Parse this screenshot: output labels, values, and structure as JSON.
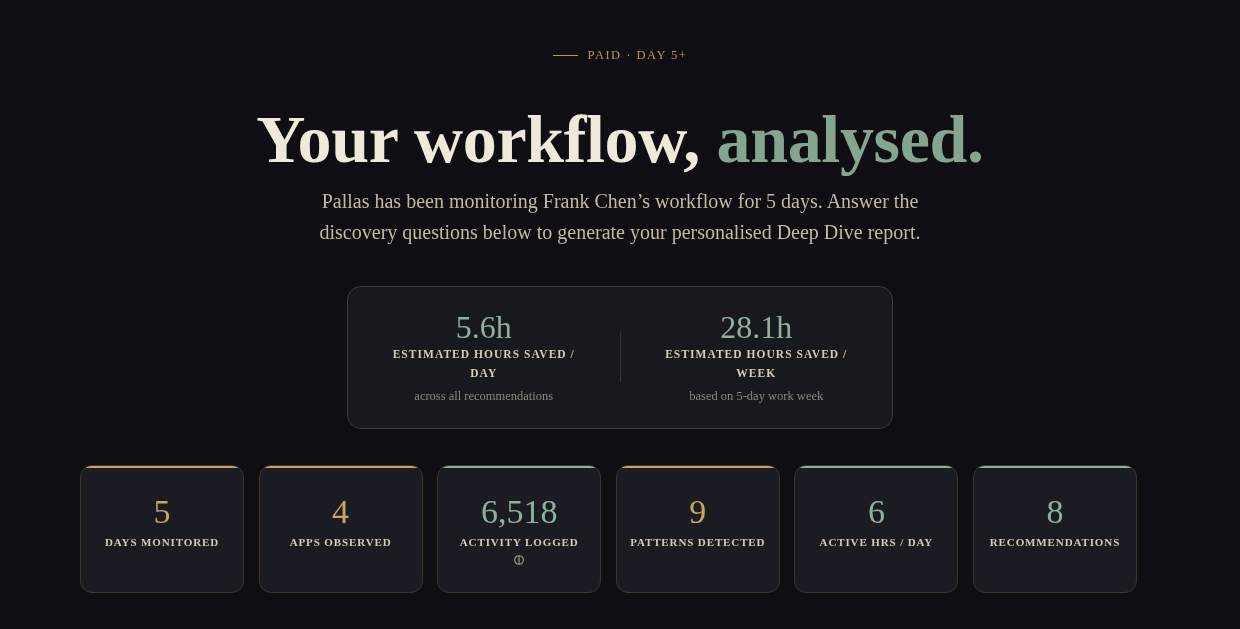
{
  "eyebrow": {
    "text": "PAID · DAY 5+"
  },
  "headline": {
    "text": "Your workflow,",
    "accent": "analysed."
  },
  "intro": "Pallas has been monitoring Frank Chen’s workflow for 5 days. Answer the discovery questions below to generate your personalised Deep Dive report.",
  "savings": [
    {
      "value": "5.6h",
      "label": "ESTIMATED HOURS SAVED / DAY",
      "note": "across all recommendations"
    },
    {
      "value": "28.1h",
      "label": "ESTIMATED HOURS SAVED / WEEK",
      "note": "based on 5-day work week"
    }
  ],
  "stats": [
    {
      "value": "5",
      "label": "DAYS MONITORED",
      "color": "#c9a45c",
      "info": false
    },
    {
      "value": "4",
      "label": "APPS OBSERVED",
      "color": "#c9a45c",
      "info": false
    },
    {
      "value": "6,518",
      "label": "ACTIVITY LOGGED",
      "color": "#8fb09c",
      "info": true
    },
    {
      "value": "9",
      "label": "PATTERNS DETECTED",
      "color": "#c9a45c",
      "info": false
    },
    {
      "value": "6",
      "label": "ACTIVE HRS / DAY",
      "color": "#8fb09c",
      "info": false
    },
    {
      "value": "8",
      "label": "RECOMMENDATIONS",
      "color": "#8fb09c",
      "info": false
    }
  ]
}
